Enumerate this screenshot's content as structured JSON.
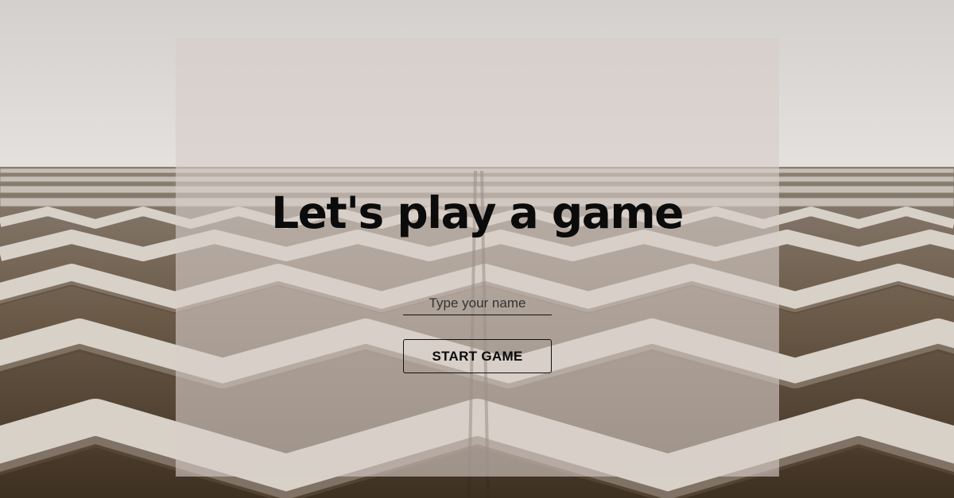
{
  "game": {
    "title": "Let's play a game",
    "name_placeholder": "Type your name",
    "name_value": "",
    "start_label": "START GAME"
  }
}
